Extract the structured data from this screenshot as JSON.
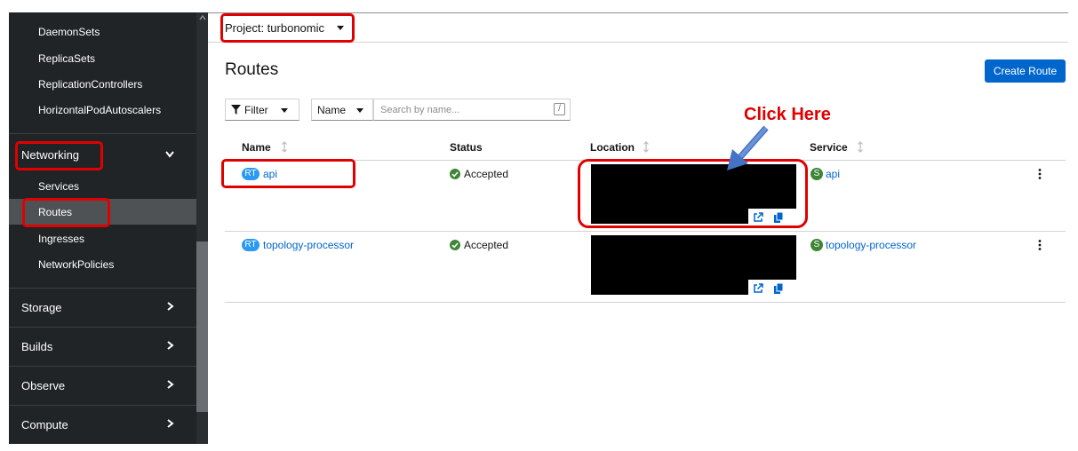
{
  "sidebar": {
    "sub_items_top": [
      "DaemonSets",
      "ReplicaSets",
      "ReplicationControllers",
      "HorizontalPodAutoscalers"
    ],
    "networking": {
      "label": "Networking",
      "items": [
        "Services",
        "Routes",
        "Ingresses",
        "NetworkPolicies"
      ],
      "active": "Routes"
    },
    "sections": [
      "Storage",
      "Builds",
      "Observe",
      "Compute"
    ]
  },
  "project_bar": {
    "label": "Project: turbonomic"
  },
  "page": {
    "title": "Routes",
    "create_button": "Create Route"
  },
  "toolbar": {
    "filter_label": "Filter",
    "name_select": "Name",
    "search_placeholder": "Search by name...",
    "search_shortcut": "/"
  },
  "table": {
    "headers": [
      "Name",
      "Status",
      "Location",
      "Service"
    ],
    "rows": [
      {
        "badge": "RT",
        "name": "api",
        "status": "Accepted",
        "service_badge": "S",
        "service": "api"
      },
      {
        "badge": "RT",
        "name": "topology-processor",
        "status": "Accepted",
        "service_badge": "S",
        "service": "topology-processor"
      }
    ]
  },
  "annotation": {
    "callout": "Click Here"
  },
  "colors": {
    "sidebar_bg": "#212427",
    "accent_blue": "#0066cc",
    "route_badge": "#2b9af3",
    "service_badge": "#3e8635",
    "annotation_red": "#e00000"
  }
}
